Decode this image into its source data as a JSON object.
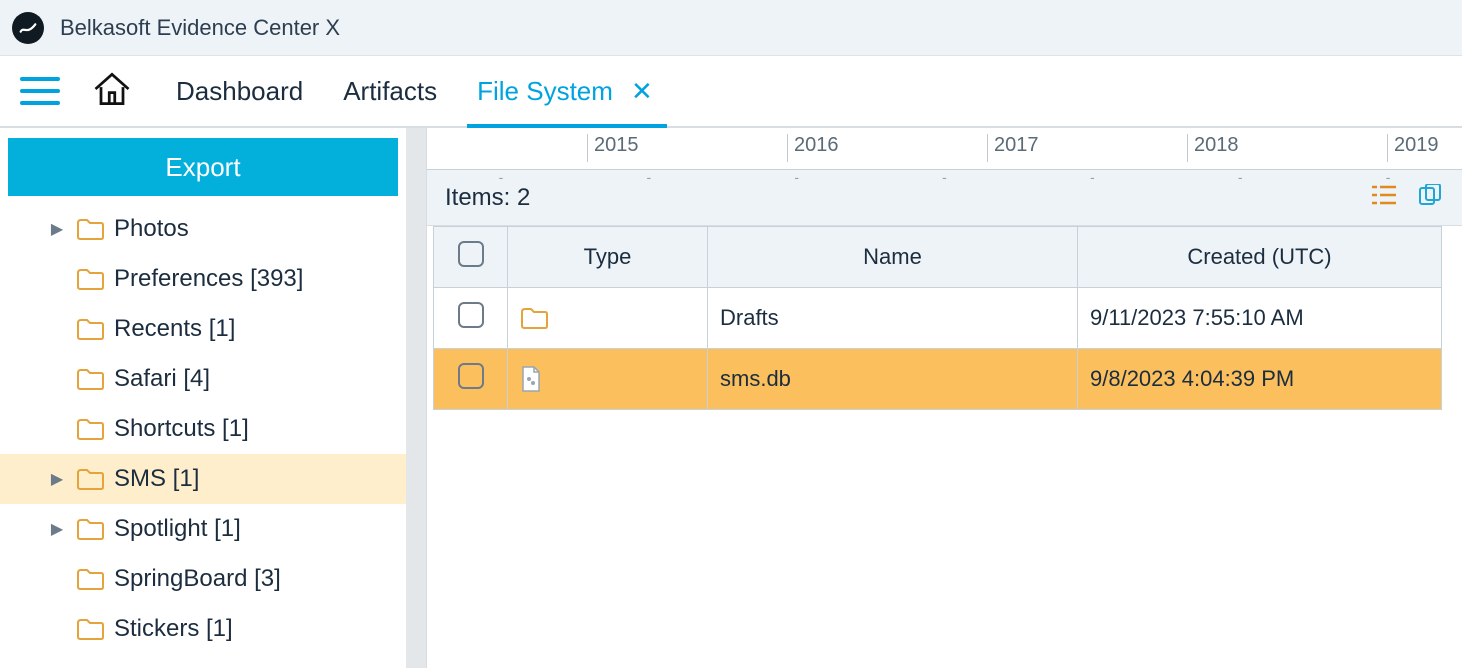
{
  "app": {
    "title": "Belkasoft Evidence Center X"
  },
  "tabs": {
    "dashboard": "Dashboard",
    "artifacts": "Artifacts",
    "filesystem": "File System"
  },
  "sidebar": {
    "export_label": "Export",
    "items": [
      {
        "label": "Photos",
        "count": null,
        "expandable": true,
        "selected": false
      },
      {
        "label": "Preferences [393]",
        "count": 393,
        "expandable": false,
        "selected": false
      },
      {
        "label": "Recents [1]",
        "count": 1,
        "expandable": false,
        "selected": false
      },
      {
        "label": "Safari [4]",
        "count": 4,
        "expandable": false,
        "selected": false
      },
      {
        "label": "Shortcuts [1]",
        "count": 1,
        "expandable": false,
        "selected": false
      },
      {
        "label": "SMS [1]",
        "count": 1,
        "expandable": true,
        "selected": true
      },
      {
        "label": "Spotlight [1]",
        "count": 1,
        "expandable": true,
        "selected": false
      },
      {
        "label": "SpringBoard [3]",
        "count": 3,
        "expandable": false,
        "selected": false
      },
      {
        "label": "Stickers [1]",
        "count": 1,
        "expandable": false,
        "selected": false
      }
    ]
  },
  "timeline": {
    "years": [
      "2015",
      "2016",
      "2017",
      "2018",
      "2019"
    ]
  },
  "items_header": {
    "label": "Items: 2"
  },
  "grid": {
    "columns": {
      "type": "Type",
      "name": "Name",
      "created": "Created (UTC)"
    },
    "rows": [
      {
        "kind": "folder",
        "name": "Drafts",
        "created": "9/11/2023 7:55:10 AM",
        "selected": false
      },
      {
        "kind": "file",
        "name": "sms.db",
        "created": "9/8/2023 4:04:39 PM",
        "selected": true
      }
    ]
  }
}
